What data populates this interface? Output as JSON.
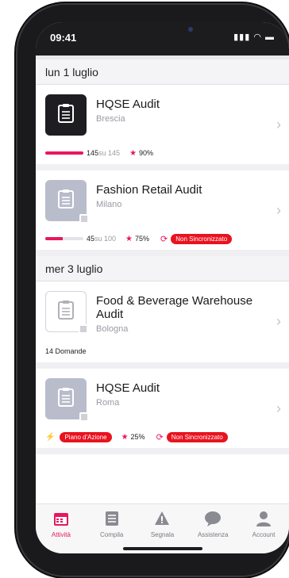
{
  "status_bar": {
    "time": "09:41",
    "signal": "▮▮▮",
    "wifi": "◠",
    "battery": "▬"
  },
  "sections": [
    {
      "date": "lun 1 luglio",
      "cards": [
        {
          "title": "HQSE Audit",
          "city": "Brescia",
          "thumb": "dark",
          "progress": 1.0,
          "count": "145",
          "of": "su 145",
          "score": "90%",
          "status": null,
          "action": null,
          "questions": null
        },
        {
          "title": "Fashion Retail Audit",
          "city": "Milano",
          "thumb": "grey",
          "progress": 0.45,
          "count": "45",
          "of": "su 100",
          "score": "75%",
          "status": "Non Sincronizzato",
          "action": null,
          "questions": null
        }
      ]
    },
    {
      "date": "mer 3 luglio",
      "cards": [
        {
          "title": "Food & Beverage Warehouse Audit",
          "city": "Bologna",
          "thumb": "outline",
          "progress": null,
          "count": null,
          "of": null,
          "score": null,
          "status": null,
          "action": null,
          "questions": "14 Domande"
        },
        {
          "title": "HQSE Audit",
          "city": "Roma",
          "thumb": "grey",
          "progress": null,
          "count": null,
          "of": null,
          "score": "25%",
          "status": "Non Sincronizzato",
          "action": "Piano d'Azione",
          "questions": null
        }
      ]
    }
  ],
  "tabs": [
    {
      "label": "Attività",
      "icon": "calendar-icon",
      "active": true
    },
    {
      "label": "Compila",
      "icon": "list-icon",
      "active": false
    },
    {
      "label": "Segnala",
      "icon": "warning-icon",
      "active": false
    },
    {
      "label": "Assistenza",
      "icon": "chat-bubble-icon",
      "active": false
    },
    {
      "label": "Account",
      "icon": "user-icon",
      "active": false
    }
  ],
  "colors": {
    "accent": "#e8175d",
    "badge": "#e8131f",
    "dark_thumb": "#1d1d22",
    "grey_thumb": "#b9bccb"
  }
}
